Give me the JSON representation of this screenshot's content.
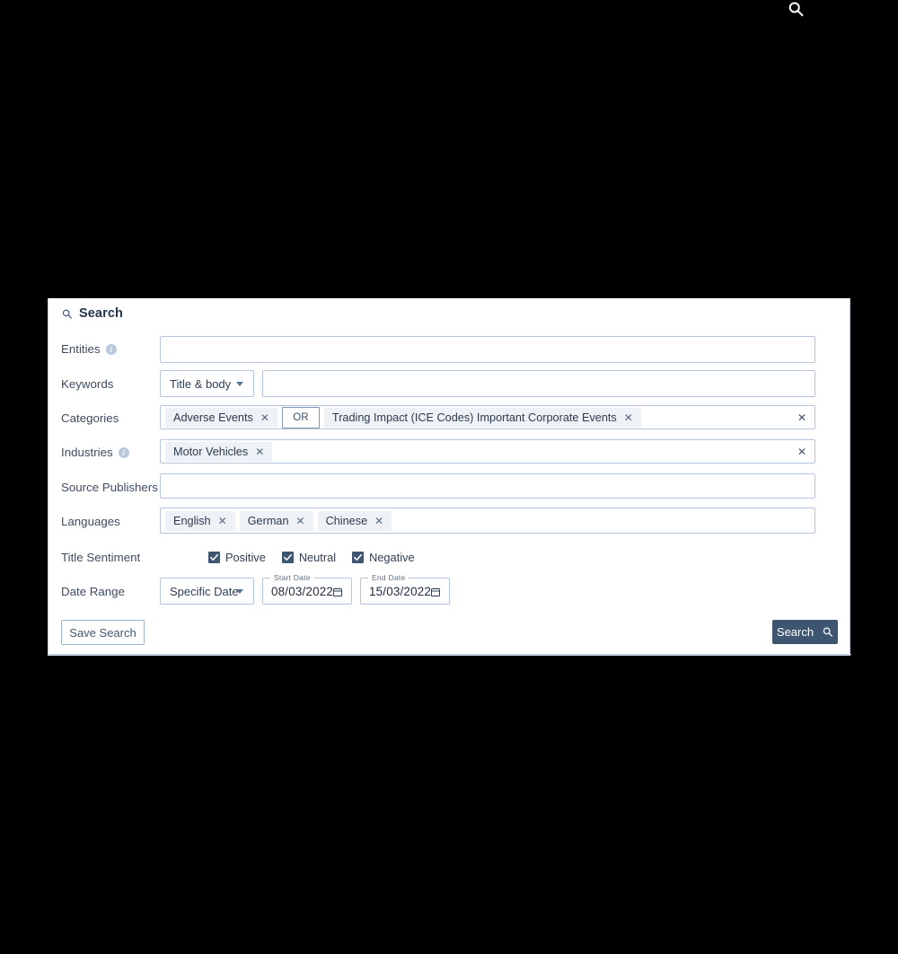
{
  "top_bar": {
    "search_icon": "search-icon"
  },
  "panel": {
    "header": {
      "icon": "search-icon",
      "title": "Search"
    },
    "rows": {
      "entities": {
        "label": "Entities",
        "info_icon": "info-icon",
        "value": "",
        "placeholder": ""
      },
      "keywords": {
        "label": "Keywords",
        "scope_select": {
          "value": "Title & body",
          "caret_icon": "chevron-down-icon"
        },
        "value": "",
        "placeholder": ""
      },
      "categories": {
        "label": "Categories",
        "chips": [
          {
            "text": "Adverse Events",
            "remove_icon": "close-icon"
          },
          {
            "text": "Trading Impact (ICE Codes) Important Corporate Events",
            "remove_icon": "close-icon"
          }
        ],
        "operator": "OR",
        "clear_icon": "close-icon"
      },
      "industries": {
        "label": "Industries",
        "info_icon": "info-icon",
        "chips": [
          {
            "text": "Motor Vehicles",
            "remove_icon": "close-icon"
          }
        ],
        "clear_icon": "close-icon"
      },
      "source_publishers": {
        "label": "Source Publishers",
        "value": "",
        "placeholder": ""
      },
      "languages": {
        "label": "Languages",
        "chips": [
          {
            "text": "English",
            "remove_icon": "close-icon"
          },
          {
            "text": "German",
            "remove_icon": "close-icon"
          },
          {
            "text": "Chinese",
            "remove_icon": "close-icon"
          }
        ]
      },
      "title_sentiment": {
        "label": "Title Sentiment",
        "options": [
          {
            "label": "Positive",
            "checked": true
          },
          {
            "label": "Neutral",
            "checked": true
          },
          {
            "label": "Negative",
            "checked": true
          }
        ]
      },
      "date_range": {
        "label": "Date Range",
        "mode_select": {
          "value": "Specific Date",
          "caret_icon": "chevron-down-icon"
        },
        "start_date": {
          "legend": "Start Date",
          "value": "08/03/2022",
          "calendar_icon": "calendar-icon"
        },
        "end_date": {
          "legend": "End Date",
          "value": "15/03/2022",
          "calendar_icon": "calendar-icon"
        }
      }
    },
    "actions": {
      "save_search": "Save Search",
      "search": "Search",
      "search_icon": "search-icon"
    }
  },
  "colors": {
    "accent": "#3e5670",
    "border": "#b6c6da",
    "chip_bg": "#eef1f6",
    "text": "#2f3e52",
    "page_bg": "#000000"
  }
}
